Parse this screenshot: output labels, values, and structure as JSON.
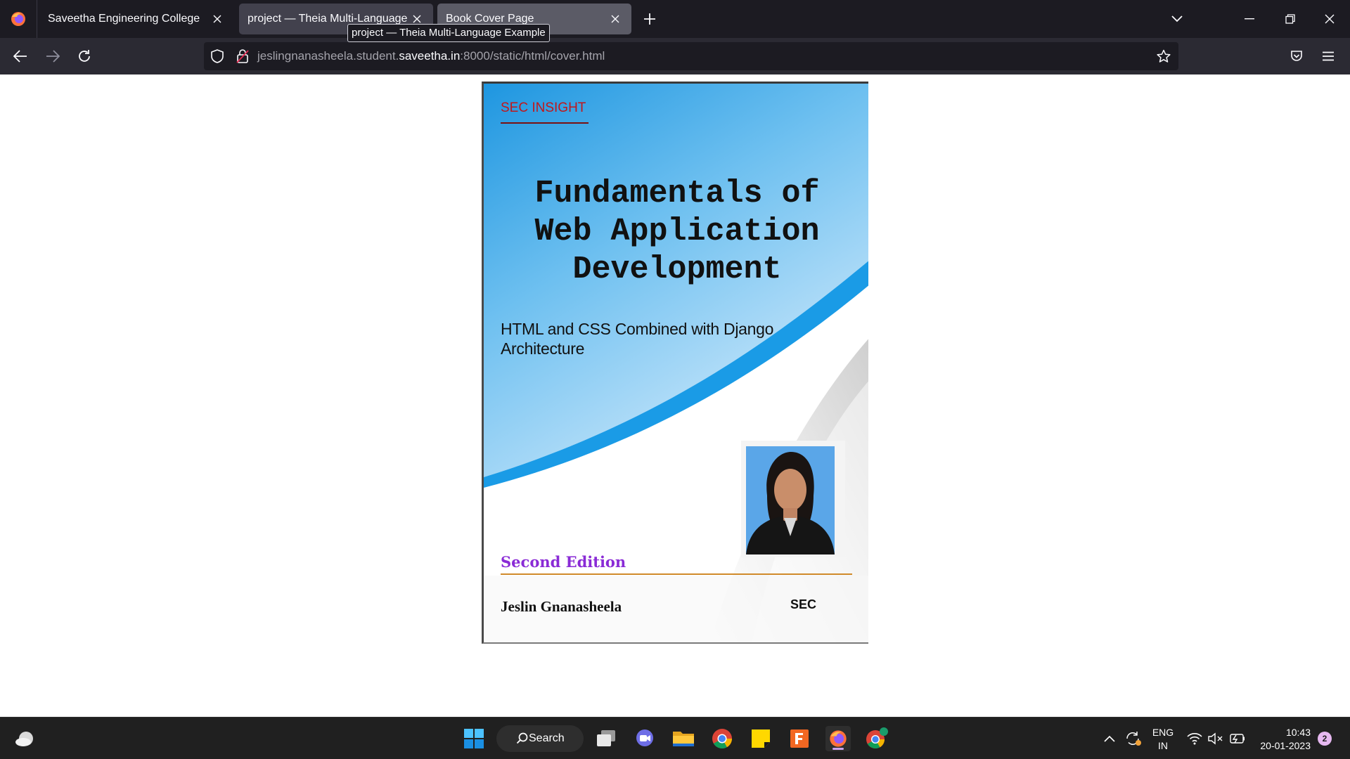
{
  "browser": {
    "tabs": [
      {
        "title": "Saveetha Engineering College",
        "active": false
      },
      {
        "title": "project — Theia Multi-Language E",
        "active": false
      },
      {
        "title": "Book Cover Page",
        "active": true
      }
    ],
    "tooltip": "project — Theia Multi-Language Example",
    "url": {
      "prefix": "jeslingnanasheela.student.",
      "host": "saveetha.in",
      "suffix": ":8000/static/html/cover.html"
    }
  },
  "cover": {
    "brand": "SEC INSIGHT",
    "title_lines": [
      "Fundamentals of",
      "Web Application",
      "Development"
    ],
    "subtitle": "HTML and CSS Combined with Django Architecture",
    "edition": "Second Edition",
    "author": "Jeslin Gnanasheela",
    "publisher": "SEC",
    "colors": {
      "brand": "#c0171b",
      "edition": "#8a2bd6",
      "rule": "#d08a2a",
      "accent_blue": "#1e9fe6"
    }
  },
  "taskbar": {
    "search_label": "Search",
    "language": {
      "line1": "ENG",
      "line2": "IN"
    },
    "time": "10:43",
    "date": "20-01-2023",
    "notification_count": "2",
    "apps": [
      "weather-icon",
      "windows-start-icon",
      "task-view-icon",
      "chat-icon",
      "file-explorer-icon",
      "chrome-icon",
      "sticky-notes-icon",
      "fusion360-icon",
      "firefox-icon",
      "chrome-profile-icon"
    ]
  }
}
